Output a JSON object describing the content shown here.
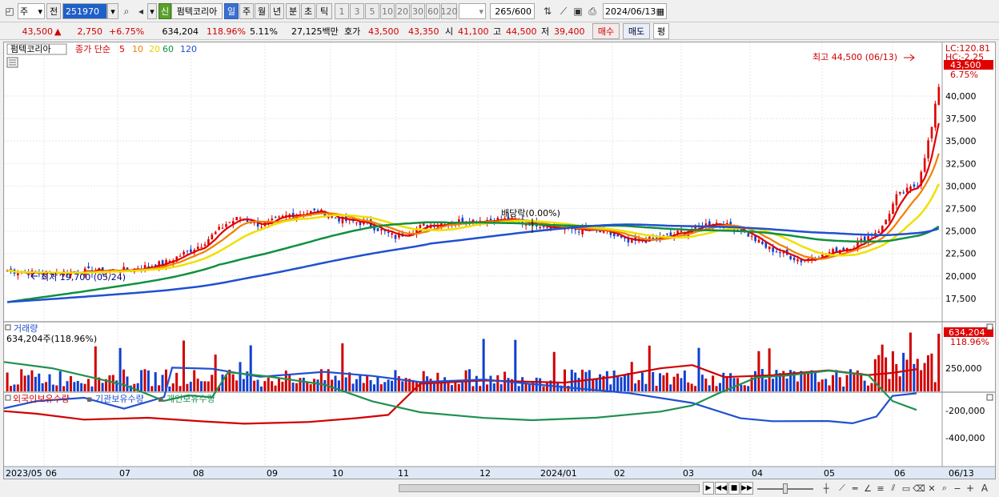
{
  "toolbar": {
    "type_select": "주",
    "prefix": "전",
    "code": "251970",
    "badge_new": "신",
    "stock_name": "펌텍코리아",
    "periods": [
      "일",
      "주",
      "월",
      "년",
      "분",
      "초",
      "틱"
    ],
    "active_period": "일",
    "intervals": [
      "1",
      "3",
      "5",
      "10",
      "20",
      "30",
      "60",
      "120"
    ],
    "count": "265",
    "count_max": "/600",
    "date": "2024/06/13"
  },
  "infobar": {
    "price": "43,500",
    "change_arrow": "▲",
    "change": "2,750",
    "change_pct": "+6.75%",
    "volume": "634,204",
    "volume_pct": "118.96%",
    "turnover_pct": "5.11%",
    "amount": "27,125백만",
    "hoga_label": "호가",
    "ask": "43,500",
    "bid": "43,350",
    "open_label": "시",
    "open": "41,100",
    "high_label": "고",
    "high": "44,500",
    "low_label": "저",
    "low": "39,400",
    "buy_label": "매수",
    "sell_label": "매도",
    "avg_label": "평"
  },
  "price_panel": {
    "name_tag": "펌텍코리아",
    "ma_label": "종가 단순",
    "ma_periods": [
      "5",
      "10",
      "20",
      "60",
      "120"
    ],
    "ma_colors": [
      "#e00000",
      "#f08000",
      "#f0e000",
      "#109040",
      "#2050d0"
    ],
    "lc_label": "LC:120.81",
    "hc_label": "HC:-2.25",
    "last_price_tag": "43,500",
    "last_pct_tag": "6.75%",
    "high_note": "최고 44,500 (06/13)",
    "low_note": "최저 19,700 (05/24)",
    "dividend_note": "배당락(0.00%)",
    "y_ticks": [
      "40,000",
      "37,500",
      "35,000",
      "32,500",
      "30,000",
      "27,500",
      "25,000",
      "22,500",
      "20,000",
      "17,500"
    ]
  },
  "volume_panel": {
    "title": "거래량",
    "value_label": "634,204주(118.96%)",
    "last_tag": "634,204",
    "last_pct_tag": "118.96%",
    "y_ticks": [
      "250,000"
    ]
  },
  "holdings_panel": {
    "legend": [
      "외국인보유수량",
      "기관보유수량",
      "개인보유수량"
    ],
    "colors": [
      "#d00000",
      "#2050d0",
      "#209050"
    ],
    "y_ticks": [
      "-200,000",
      "-400,000"
    ]
  },
  "x_axis": {
    "labels": [
      "2023/05",
      "06",
      "07",
      "08",
      "09",
      "10",
      "11",
      "12",
      "2024/01",
      "02",
      "03",
      "04",
      "05",
      "06"
    ],
    "last_label": "06/13"
  }
}
